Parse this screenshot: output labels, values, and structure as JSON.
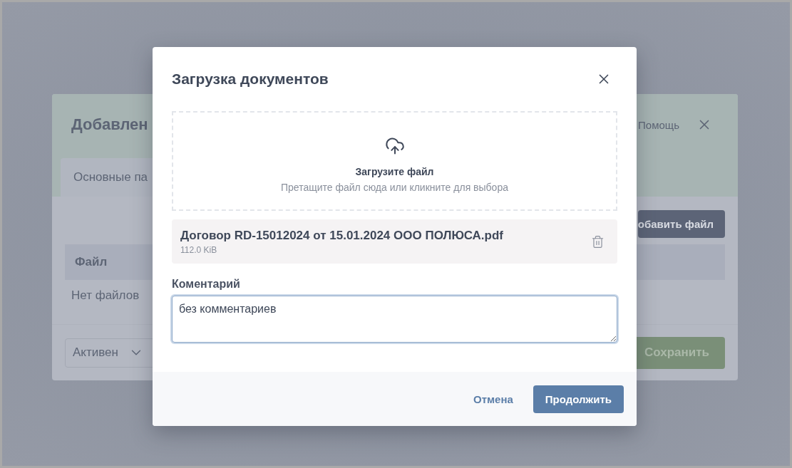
{
  "back_dialog": {
    "title": "Добавлен",
    "help": "Помощь",
    "tabs": [
      {
        "label": "Основные па",
        "selected": true
      }
    ],
    "add_button": "обавить файл",
    "table": {
      "columns": [
        "Файл"
      ],
      "empty_text": "Нет файлов"
    },
    "status_select": {
      "value": "Активен"
    },
    "save_button": "Сохранить"
  },
  "modal": {
    "title": "Загрузка документов",
    "dropzone": {
      "title": "Загрузите файл",
      "hint": "Претащите файл сюда или кликните для выбора"
    },
    "files": [
      {
        "name": "Договор RD-15012024 от 15.01.2024 ООО ПОЛЮСА.pdf",
        "size": "112.0 KiB"
      }
    ],
    "comment": {
      "label": "Коментарий",
      "value": "без комментариев",
      "focused": true
    },
    "buttons": [
      {
        "label": "Отмена",
        "kind": "link"
      },
      {
        "label": "Продолжить",
        "kind": "primary"
      }
    ]
  }
}
